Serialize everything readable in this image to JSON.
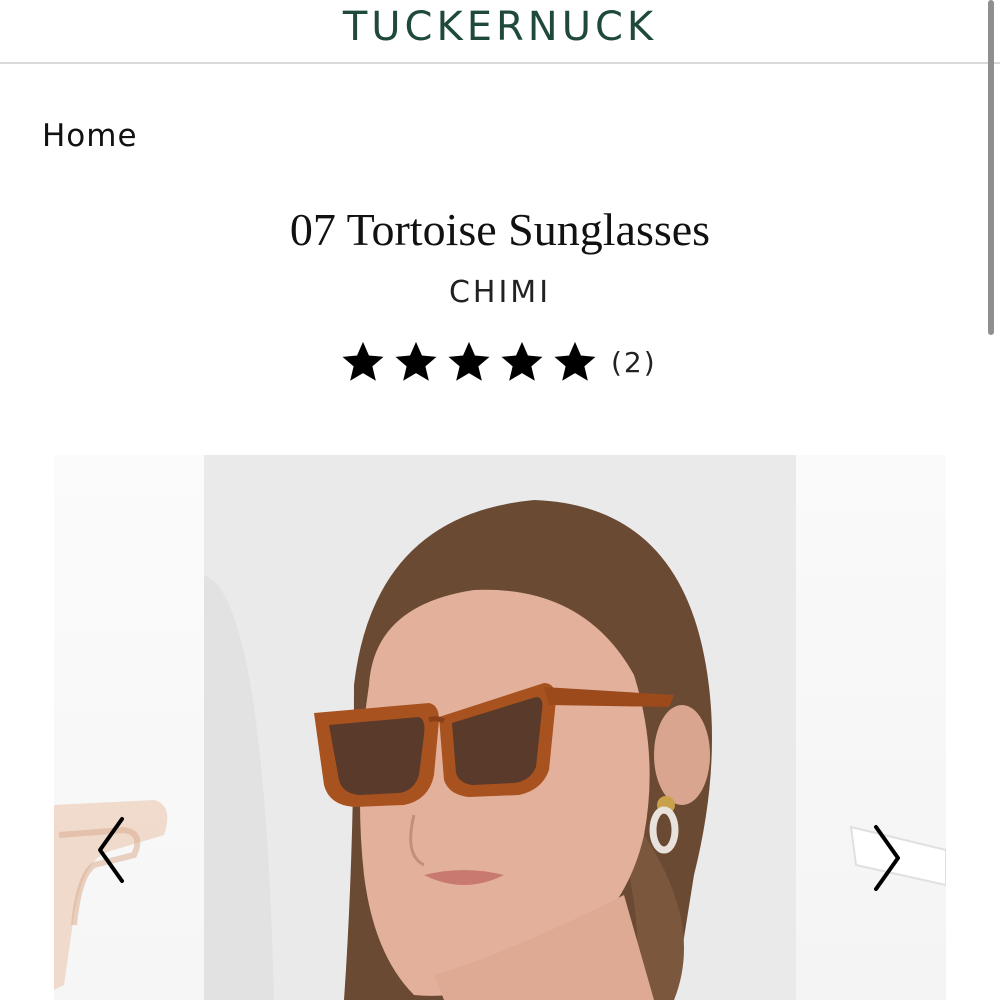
{
  "header": {
    "brand": "TUCKERNUCK"
  },
  "breadcrumb": {
    "home": "Home"
  },
  "product": {
    "title": "07 Tortoise Sunglasses",
    "brand": "CHIMI",
    "rating": 5,
    "review_count_label": "(2)"
  },
  "gallery": {
    "main_image_icon": "model-wearing-tortoise-sunglasses-image",
    "prev_icon": "chevron-left-icon",
    "next_icon": "chevron-right-icon"
  },
  "colors": {
    "brand_green": "#1f4a3a",
    "tortoise": "#a8521f",
    "lens": "#5a3a2a"
  }
}
